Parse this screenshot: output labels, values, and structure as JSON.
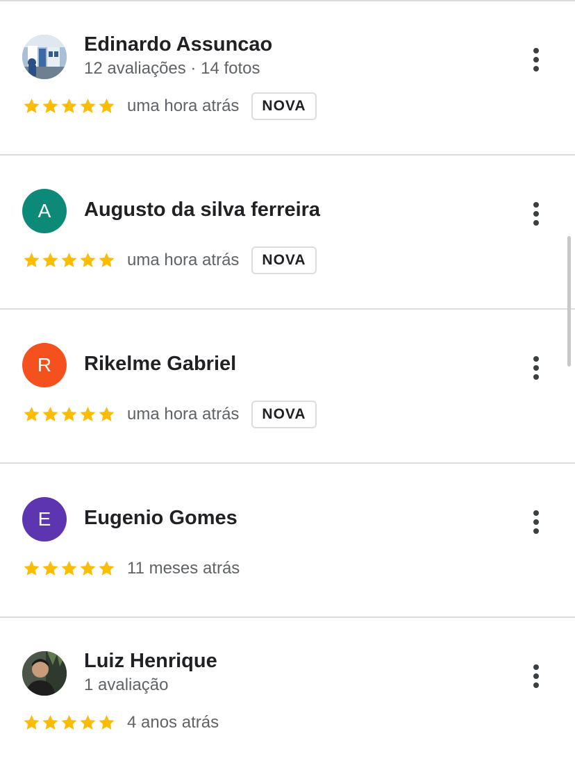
{
  "badge_label": "NOVA",
  "star_color": "#fbbc04",
  "reviews": [
    {
      "name": "Edinardo Assuncao",
      "meta": "12 avaliações · 14 fotos",
      "rating": 5,
      "time": "uma hora atrás",
      "is_new": true,
      "avatar": {
        "type": "photo",
        "icon": "store-photo"
      }
    },
    {
      "name": "Augusto da silva ferreira",
      "meta": "",
      "rating": 5,
      "time": "uma hora atrás",
      "is_new": true,
      "avatar": {
        "type": "initial",
        "letter": "A",
        "color": "#0d8a77"
      }
    },
    {
      "name": "Rikelme Gabriel",
      "meta": "",
      "rating": 5,
      "time": "uma hora atrás",
      "is_new": true,
      "avatar": {
        "type": "initial",
        "letter": "R",
        "color": "#f4511e"
      }
    },
    {
      "name": "Eugenio Gomes",
      "meta": "",
      "rating": 5,
      "time": "11 meses atrás",
      "is_new": false,
      "avatar": {
        "type": "initial",
        "letter": "E",
        "color": "#5e35b1"
      }
    },
    {
      "name": "Luiz Henrique",
      "meta": "1 avaliação",
      "rating": 5,
      "time": "4 anos atrás",
      "is_new": false,
      "avatar": {
        "type": "photo",
        "icon": "person-photo"
      }
    }
  ]
}
